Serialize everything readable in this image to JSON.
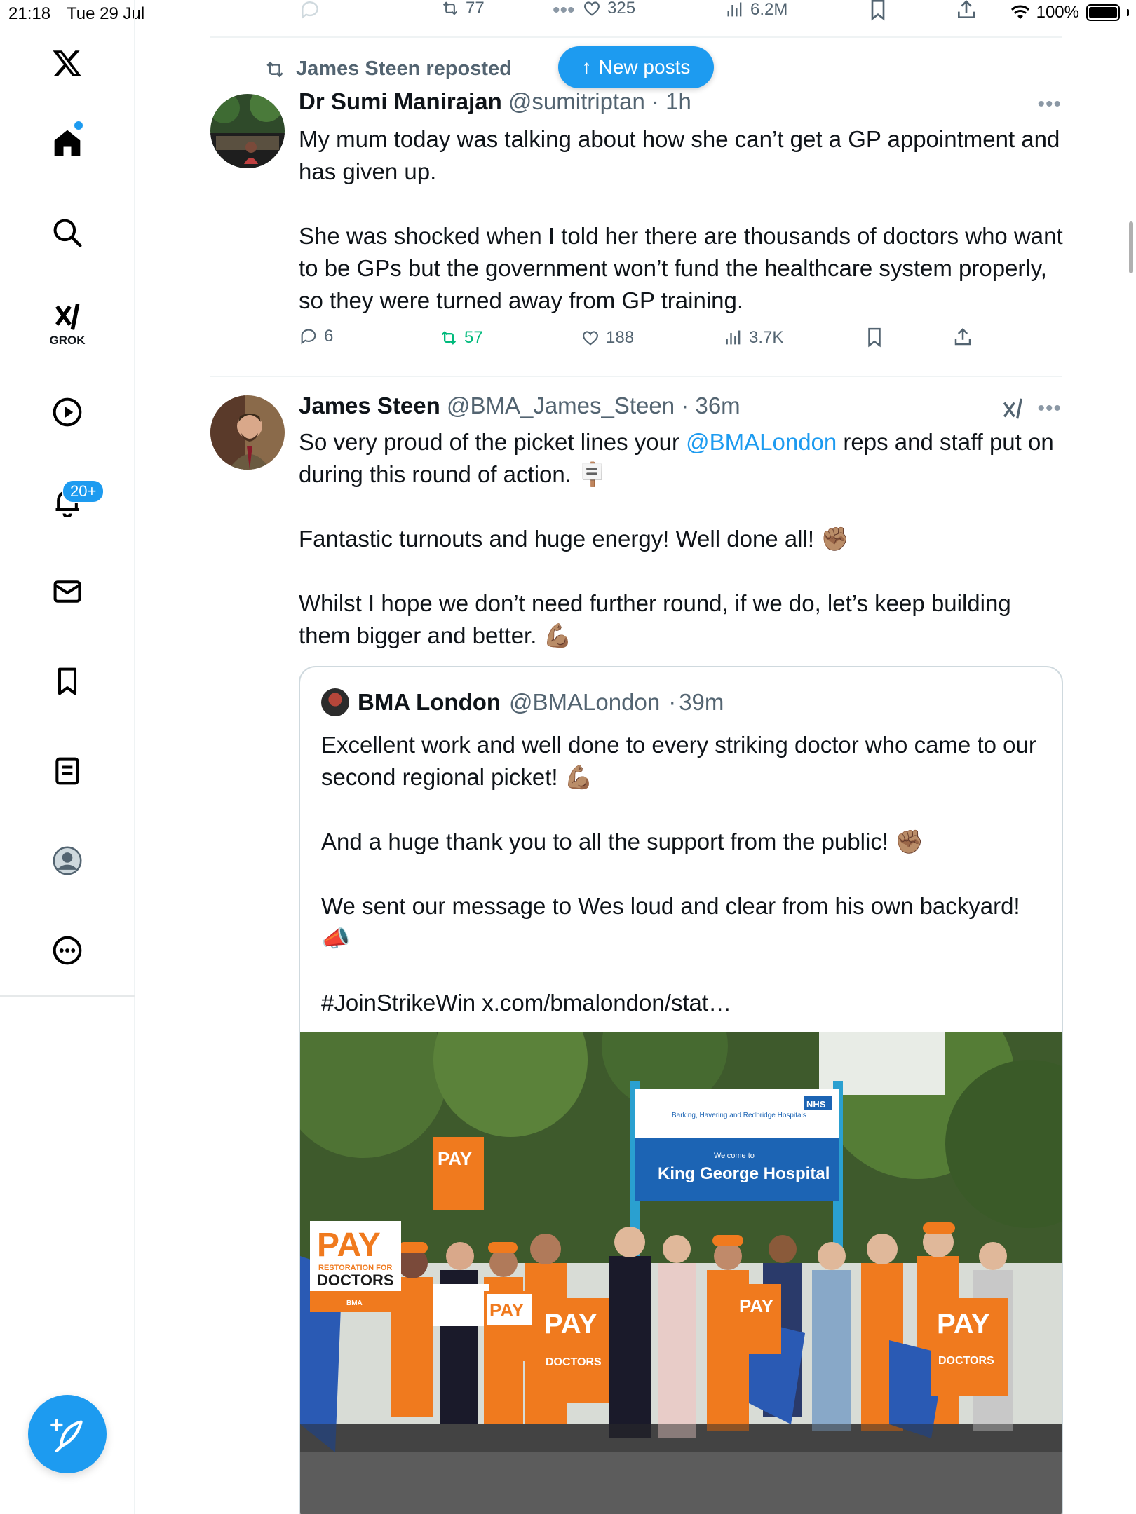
{
  "status_bar": {
    "time": "21:18",
    "date": "Tue 29 Jul",
    "battery": "100%"
  },
  "sidebar": {
    "items": [
      {
        "name": "home",
        "icon": "home-icon"
      },
      {
        "name": "explore",
        "icon": "search-icon"
      },
      {
        "name": "grok",
        "icon": "grok-icon",
        "label": "GROK"
      },
      {
        "name": "video",
        "icon": "play-icon"
      },
      {
        "name": "notifications",
        "icon": "bell-icon",
        "badge": "20+"
      },
      {
        "name": "messages",
        "icon": "mail-icon"
      },
      {
        "name": "bookmarks",
        "icon": "bookmark-icon"
      },
      {
        "name": "lists",
        "icon": "list-icon"
      },
      {
        "name": "profile",
        "icon": "profile-icon"
      },
      {
        "name": "more",
        "icon": "more-icon"
      }
    ],
    "compose_icon": "compose-icon"
  },
  "prev_post_actions": {
    "retweets": "77",
    "likes": "325",
    "views": "6.2M"
  },
  "new_posts": {
    "label": "New posts"
  },
  "post1": {
    "repost_label": "James Steen reposted",
    "name": "Dr Sumi Manirajan",
    "handle": "@sumitriptan",
    "time": "1h",
    "paragraphs": [
      "My mum today was talking about how she can’t get a GP appointment and has given up.",
      "She was shocked when I told her there are thousands of doctors who want to be GPs but the government won’t fund the healthcare system properly, so they were turned away from GP training."
    ],
    "replies": "6",
    "retweets": "57",
    "likes": "188",
    "views": "3.7K"
  },
  "post2": {
    "name": "James Steen",
    "handle": "@BMA_James_Steen",
    "time": "36m",
    "text_before_mention": "So very proud of the picket lines your ",
    "mention": "@BMALondon",
    "text_after_mention": " reps and staff put on during this round of action. 🪧",
    "paragraphs": [
      "Fantastic turnouts and huge energy! Well done all! ✊🏽",
      "Whilst I hope we don’t need further round, if we do, let’s keep building them bigger and better. 💪🏽"
    ],
    "quote": {
      "name": "BMA London",
      "handle": "@BMALondon",
      "time": "39m",
      "paragraphs": [
        "Excellent work and well done to every striking doctor who came to our second regional picket! 💪🏽",
        "And a huge thank you to all the support from the public! ✊🏽",
        "We sent our message to Wes loud and clear from his own backyard! 📣",
        "#JoinStrikeWin x.com/bmalondon/stat…"
      ],
      "image": {
        "hospital_sign_small": "Barking, Havering and Redbridge Hospitals",
        "nhs": "NHS",
        "welcome": "Welcome to",
        "hospital_name": "King George Hospital",
        "placard_pay": "PAY",
        "placard_sub": "RESTORATION FOR",
        "placard_doctors": "DOCTORS",
        "bma": "BMA"
      }
    }
  }
}
